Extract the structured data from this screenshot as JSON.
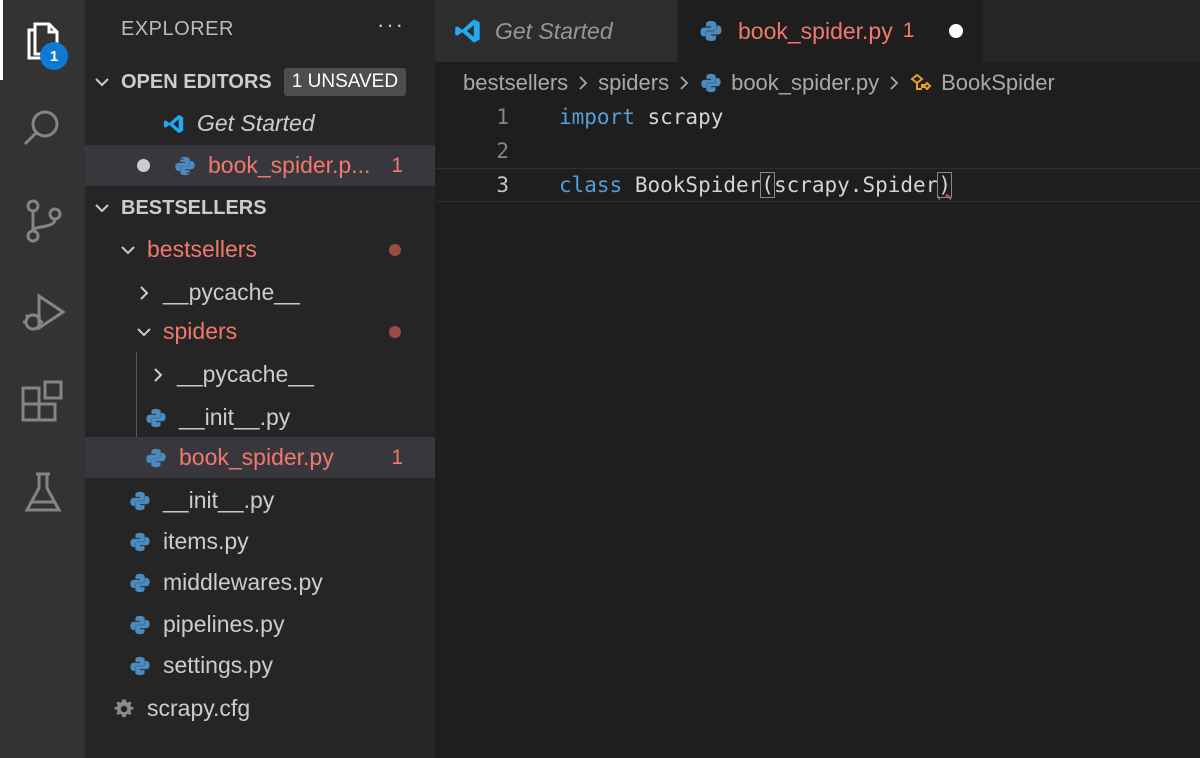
{
  "activity_bar": {
    "items": [
      {
        "name": "explorer-icon"
      },
      {
        "name": "search-icon"
      },
      {
        "name": "source-control-icon"
      },
      {
        "name": "run-debug-icon"
      },
      {
        "name": "extensions-icon"
      },
      {
        "name": "testing-icon"
      }
    ],
    "explorer_badge": "1"
  },
  "sidebar": {
    "title": "EXPLORER",
    "more_label": "···",
    "open_editors": {
      "label": "OPEN EDITORS",
      "badge": "1 UNSAVED",
      "items": [
        {
          "label": "Get Started",
          "icon": "vscode-icon"
        },
        {
          "label": "book_spider.p...",
          "icon": "python-icon",
          "problems": "1",
          "dirty": true
        }
      ]
    },
    "project": {
      "label": "BESTSELLERS",
      "tree": [
        {
          "label": "bestsellers",
          "type": "folder",
          "expanded": true,
          "modified": true
        },
        {
          "label": "__pycache__",
          "type": "folder",
          "expanded": false
        },
        {
          "label": "spiders",
          "type": "folder",
          "expanded": true,
          "modified": true
        },
        {
          "label": "__pycache__",
          "type": "folder",
          "expanded": false
        },
        {
          "label": "__init__.py",
          "type": "python"
        },
        {
          "label": "book_spider.py",
          "type": "python",
          "problems": "1",
          "selected": true
        },
        {
          "label": "__init__.py",
          "type": "python"
        },
        {
          "label": "items.py",
          "type": "python"
        },
        {
          "label": "middlewares.py",
          "type": "python"
        },
        {
          "label": "pipelines.py",
          "type": "python"
        },
        {
          "label": "settings.py",
          "type": "python"
        },
        {
          "label": "scrapy.cfg",
          "type": "gear"
        }
      ]
    }
  },
  "editor": {
    "tabs": [
      {
        "label": "Get Started",
        "icon": "vscode-icon",
        "active": false
      },
      {
        "label": "book_spider.py",
        "icon": "python-icon",
        "problems": "1",
        "active": true,
        "dirty": true
      }
    ],
    "breadcrumb": [
      "bestsellers",
      "spiders",
      "book_spider.py",
      "BookSpider"
    ],
    "lines": [
      {
        "number": "1",
        "keyword": "import",
        "rest": " scrapy"
      },
      {
        "number": "2"
      },
      {
        "number": "3",
        "keyword": "class",
        "class_name": " BookSpider",
        "open_paren": "(",
        "args": "scrapy.Spider",
        "close_paren": ")"
      }
    ]
  },
  "colors": {
    "modified": "#f1796b",
    "keyword": "#569cd6",
    "badge": "#0e7ad3",
    "python_blue": "#4b8bbe",
    "vscode_blue": "#23a9f2"
  }
}
